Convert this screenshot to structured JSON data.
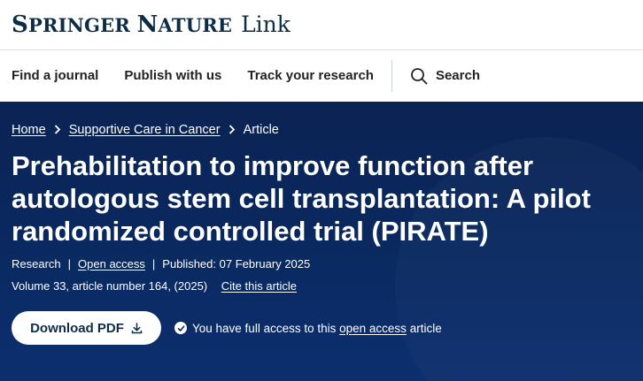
{
  "brand": {
    "name": "Springer Nature",
    "product": "Link"
  },
  "nav": {
    "items": [
      "Find a journal",
      "Publish with us",
      "Track your research"
    ],
    "search_label": "Search"
  },
  "breadcrumb": {
    "home": "Home",
    "journal": "Supportive Care in Cancer",
    "current": "Article"
  },
  "article": {
    "title": "Prehabilitation to improve function after autologous stem cell transplantation: A pilot randomized controlled trial (PIRATE)",
    "type": "Research",
    "access_label": "Open access",
    "published": "Published: 07 February 2025",
    "volume_info": "Volume 33, article number 164, (2025)",
    "cite_label": "Cite this article"
  },
  "actions": {
    "download_label": "Download PDF",
    "access_prefix": "You have full access to this",
    "access_link": "open access",
    "access_suffix": "article"
  },
  "colors": {
    "brand_navy": "#0c2d48",
    "hero_bg": "#0a2a63"
  }
}
